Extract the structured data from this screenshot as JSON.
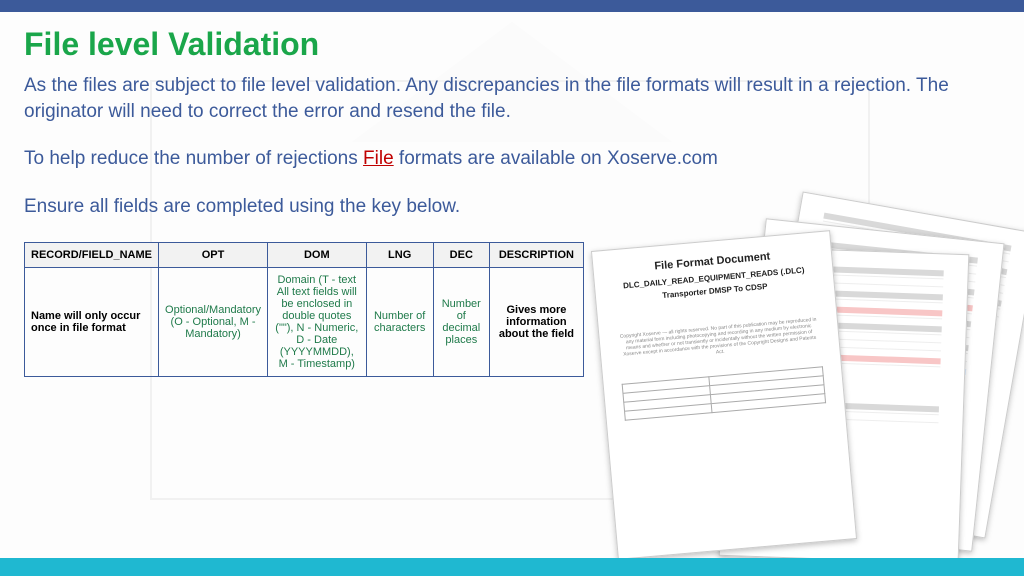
{
  "title": "File level Validation",
  "para1": "As the files are subject to file level validation. Any discrepancies in the file formats will result in a rejection. The originator will need to correct the error and resend the file.",
  "para2_pre": "To help reduce the number of rejections ",
  "para2_link": "File",
  "para2_post": " formats are available on Xoserve.com",
  "para3": "Ensure all fields are completed using the key below.",
  "table": {
    "headers": [
      "RECORD/FIELD_NAME",
      "OPT",
      "DOM",
      "LNG",
      "DEC",
      "DESCRIPTION"
    ],
    "row": {
      "name": "Name will only occur once in file format",
      "opt": "Optional/Mandatory (O - Optional, M - Mandatory)",
      "dom": "Domain (T - text All text fields will be enclosed in double quotes (\"\"), N - Numeric, D - Date (YYYYMMDD), M - Timestamp)",
      "lng": "Number of characters",
      "dec": "Number of decimal places",
      "desc": "Gives more information about the field"
    }
  },
  "doc": {
    "title": "File Format Document",
    "sub": "DLC_DAILY_READ_EQUIPMENT_READS (.DLC)",
    "sub2": "Transporter DMSP To CDSP"
  }
}
